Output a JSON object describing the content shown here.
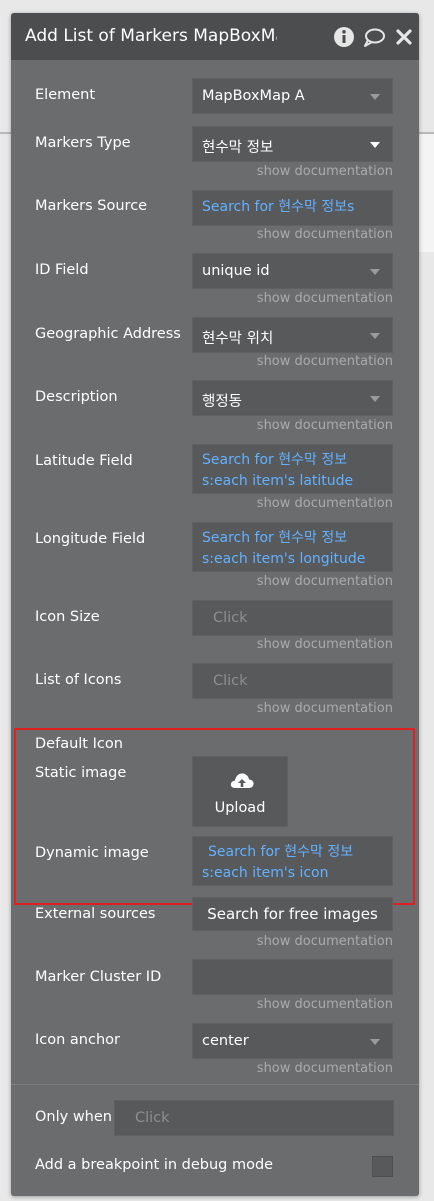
{
  "panel": {
    "title": "Add List of Markers MapBoxMap",
    "icons": [
      "info-icon",
      "comment-icon",
      "close-icon"
    ]
  },
  "rows": {
    "element": {
      "label": "Element",
      "value": "MapBoxMap A"
    },
    "markers_type": {
      "label": "Markers Type",
      "value": "현수막 정보",
      "doc": "show documentation"
    },
    "markers_source": {
      "label": "Markers Source",
      "value": "Search for 현수막 정보s",
      "doc": "show documentation"
    },
    "id_field": {
      "label": "ID Field",
      "value": "unique id",
      "doc": "show documentation"
    },
    "geo_address": {
      "label": "Geographic Address F",
      "value": "현수막 위치",
      "doc": "show documentation"
    },
    "description": {
      "label": "Description",
      "value": "행정동",
      "doc": "show documentation"
    },
    "latitude": {
      "label": "Latitude Field",
      "line1": "Search for 현수막 정보",
      "line2": "s:each item's latitude",
      "doc": "show documentation"
    },
    "longitude": {
      "label": "Longitude Field",
      "line1": "Search for 현수막 정보",
      "line2": "s:each item's longitude",
      "doc": "show documentation"
    },
    "icon_size": {
      "label": "Icon Size",
      "placeholder": "Click",
      "doc": "show documentation"
    },
    "list_icons": {
      "label": "List of Icons",
      "placeholder": "Click",
      "doc": "show documentation"
    }
  },
  "default_icon": {
    "heading": "Default Icon",
    "static_label": "Static image",
    "upload_label": "Upload",
    "dynamic_label": "Dynamic image",
    "dynamic_line1": "Search for 현수막 정보",
    "dynamic_line2": "s:each item's icon"
  },
  "external": {
    "label": "External sources",
    "button": "Search for free images",
    "doc": "show documentation"
  },
  "cluster": {
    "label": "Marker Cluster ID",
    "doc": "show documentation"
  },
  "anchor": {
    "label": "Icon anchor",
    "value": "center",
    "doc": "show documentation"
  },
  "only_when": {
    "label": "Only when",
    "placeholder": "Click"
  },
  "breakpoint": {
    "label": "Add a breakpoint in debug mode"
  },
  "colors": {
    "panel": "#6a6c6e",
    "header": "#4b4d4f",
    "link": "#63b1ff",
    "highlight": "#e02020"
  }
}
